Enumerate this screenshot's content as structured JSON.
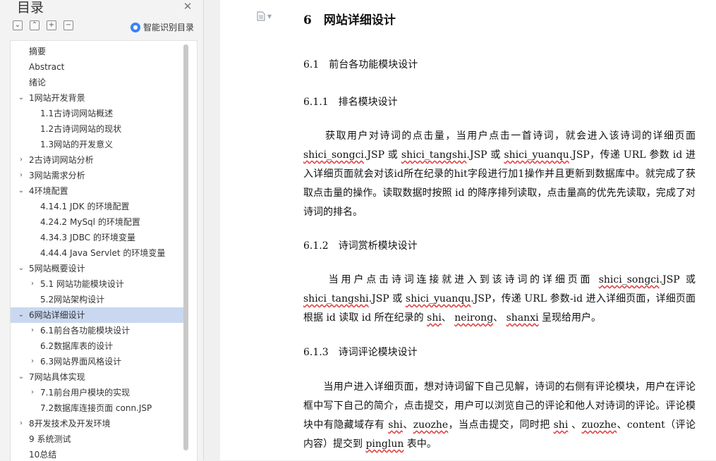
{
  "sidebar": {
    "title": "目录",
    "ai_label": "智能识别目录",
    "items": [
      {
        "label": "摘要",
        "level": 1,
        "expand": "none"
      },
      {
        "label": "Abstract",
        "level": 1,
        "expand": "none"
      },
      {
        "label": "绪论",
        "level": 1,
        "expand": "none"
      },
      {
        "label": "1网站开发背景",
        "level": 1,
        "expand": "open"
      },
      {
        "label": "1.1古诗词网站概述",
        "level": 2,
        "expand": "none"
      },
      {
        "label": "1.2古诗词网站的现状",
        "level": 2,
        "expand": "none"
      },
      {
        "label": "1.3网站的开发意义",
        "level": 2,
        "expand": "none"
      },
      {
        "label": "2古诗词网站分析",
        "level": 1,
        "expand": "closed"
      },
      {
        "label": "3网站需求分析",
        "level": 1,
        "expand": "closed"
      },
      {
        "label": "4环境配置",
        "level": 1,
        "expand": "open"
      },
      {
        "label": "4.14.1 JDK 的环境配置",
        "level": 2,
        "expand": "none"
      },
      {
        "label": "4.24.2 MySql 的环境配置",
        "level": 2,
        "expand": "none"
      },
      {
        "label": "4.34.3 JDBC 的环境变量",
        "level": 2,
        "expand": "none"
      },
      {
        "label": "4.44.4 Java Servlet 的环境变量",
        "level": 2,
        "expand": "none"
      },
      {
        "label": "5网站概要设计",
        "level": 1,
        "expand": "open"
      },
      {
        "label": "5.1 网站功能模块设计",
        "level": 2,
        "expand": "closed"
      },
      {
        "label": "5.2网站架构设计",
        "level": 2,
        "expand": "none"
      },
      {
        "label": "6网站详细设计",
        "level": 1,
        "expand": "open",
        "selected": true
      },
      {
        "label": "6.1前台各功能模块设计",
        "level": 2,
        "expand": "closed"
      },
      {
        "label": "6.2数据库表的设计",
        "level": 2,
        "expand": "none"
      },
      {
        "label": "6.3网站界面风格设计",
        "level": 2,
        "expand": "closed"
      },
      {
        "label": "7网站具体实现",
        "level": 1,
        "expand": "open"
      },
      {
        "label": "7.1前台用户模块的实现",
        "level": 2,
        "expand": "closed"
      },
      {
        "label": "7.2数据库连接页面 conn.JSP",
        "level": 2,
        "expand": "none"
      },
      {
        "label": "8开发技术及开发环境",
        "level": 1,
        "expand": "closed"
      },
      {
        "label": "9 系统测试",
        "level": 1,
        "expand": "none"
      },
      {
        "label": "10总结",
        "level": 1,
        "expand": "none"
      }
    ]
  },
  "document": {
    "h1": "6　网站详细设计",
    "h2": "6.1　前台各功能模块设计",
    "s1_title": "6.1.1　排名模块设计",
    "s2_title": "6.1.2　诗词赏析模块设计",
    "s3_title": "6.1.3　诗词评论模块设计",
    "p1": [
      "　　获取用户对诗词的点击量，当用户点击一首诗词，就会进入该诗词的详细页面 ",
      {
        "u": "shici_songci"
      },
      ".JSP 或 ",
      {
        "u": "shici_tangshi"
      },
      ".JSP 或 ",
      {
        "u": "shici_yuanqu"
      },
      ".JSP，传递 URL 参数 id 进入详细页面就会对该id所在纪录的hit字段进行加1操作并且更新到数据库中。就完成了获取点击量的操作。读取数据时按照 id 的降序排列读取，点击量高的优先先读取，完成了对诗词的排名。"
    ],
    "p2": [
      "　　当用户点击诗词连接就进入到该诗词的详细页面 ",
      {
        "u": "shici_songci"
      },
      ".JSP 或 ",
      {
        "u": "shici_tangshi"
      },
      ".JSP 或 ",
      {
        "u": "shici_yuanqu"
      },
      ".JSP，传递 URL 参数-id 进入详细页面，详细页面根据 id 读取 id 所在纪录的 ",
      {
        "u": "shi"
      },
      "、 ",
      {
        "u": "neirong"
      },
      "、 ",
      {
        "u": "shanxi"
      },
      " 呈现给用户。"
    ],
    "p3": [
      "　　当用户进入详细页面，想对诗词留下自己见解，诗词的右侧有评论模块，用户在评论框中写下自己的简介，点击提交，用户可以浏览自己的评论和他人对诗词的评论。评论模块中有隐藏域存有 ",
      {
        "u": "shi"
      },
      "、",
      {
        "u": "zuozhe"
      },
      "，当点击提交，同时把 ",
      {
        "u": "shi"
      },
      " 、",
      {
        "u": "zuozhe"
      },
      "、content（评论内容）提交到 ",
      {
        "u": "pinglun"
      },
      " 表中。"
    ]
  }
}
